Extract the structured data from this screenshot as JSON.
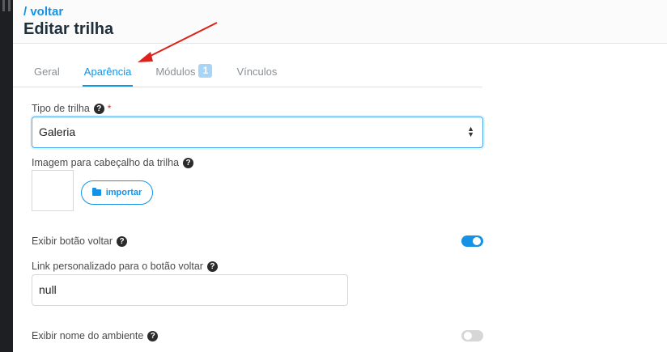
{
  "header": {
    "back_link": "/ voltar",
    "title": "Editar trilha"
  },
  "tabs": [
    {
      "label": "Geral",
      "active": false
    },
    {
      "label": "Aparência",
      "active": true
    },
    {
      "label": "Módulos",
      "badge": "1",
      "active": false
    },
    {
      "label": "Vínculos",
      "active": false
    }
  ],
  "form": {
    "tipo_trilha": {
      "label": "Tipo de trilha",
      "required_mark": "*",
      "value": "Galeria"
    },
    "imagem": {
      "label": "Imagem para cabeçalho da trilha",
      "import_label": "importar"
    },
    "exibir_botao_voltar": {
      "label": "Exibir botão voltar",
      "enabled": true
    },
    "link_personalizado": {
      "label": "Link personalizado para o botão voltar",
      "value": "null"
    },
    "exibir_nome_ambiente": {
      "label": "Exibir nome do ambiente",
      "enabled": false
    }
  },
  "colors": {
    "accent": "#1592e6",
    "annotation_arrow": "#e0201b",
    "required": "#e02424"
  },
  "icons": {
    "help": "question-circle-icon",
    "folder": "folder-open-icon",
    "select": "sort-arrows-icon"
  }
}
